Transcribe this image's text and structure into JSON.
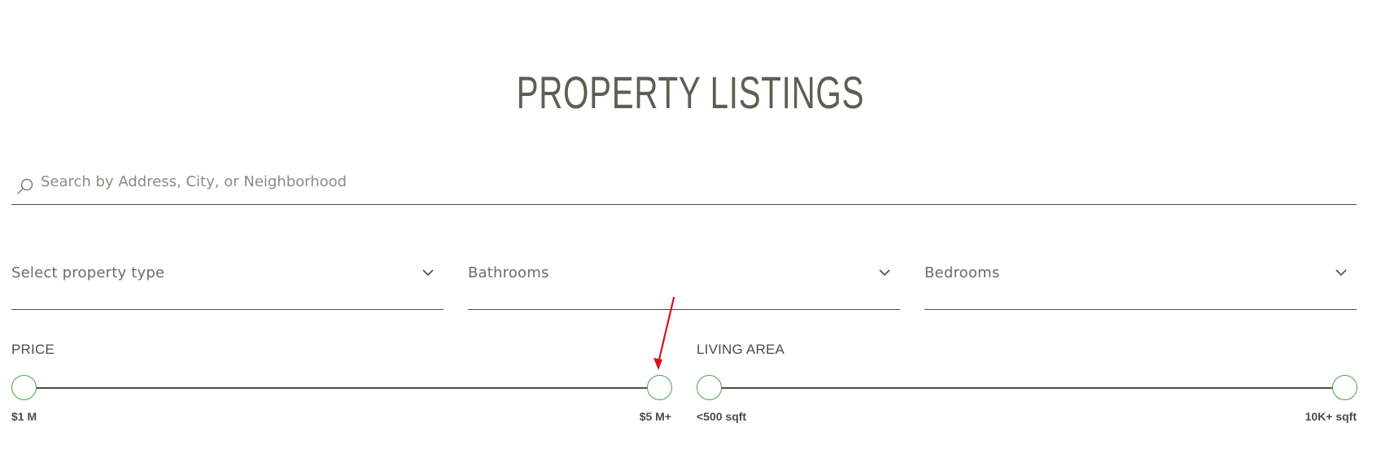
{
  "header": {
    "title": "PROPERTY LISTINGS"
  },
  "search": {
    "placeholder": "Search by Address, City, or Neighborhood",
    "icon": "search-icon"
  },
  "filters": {
    "property_type": {
      "label": "Select property type",
      "icon": "chevron-down-icon"
    },
    "bathrooms": {
      "label": "Bathrooms",
      "icon": "chevron-down-icon"
    },
    "bedrooms": {
      "label": "Bedrooms",
      "icon": "chevron-down-icon"
    }
  },
  "price": {
    "title": "PRICE",
    "min_label": "$1 M",
    "max_label": "$5 M+"
  },
  "living_area": {
    "title": "LIVING AREA",
    "min_label": "<500 sqft",
    "max_label": "10K+ sqft"
  },
  "colors": {
    "text": "#5f5e52",
    "line": "#4d4d44",
    "handle_border": "#4aa24a",
    "annotation": "#d0151b"
  }
}
